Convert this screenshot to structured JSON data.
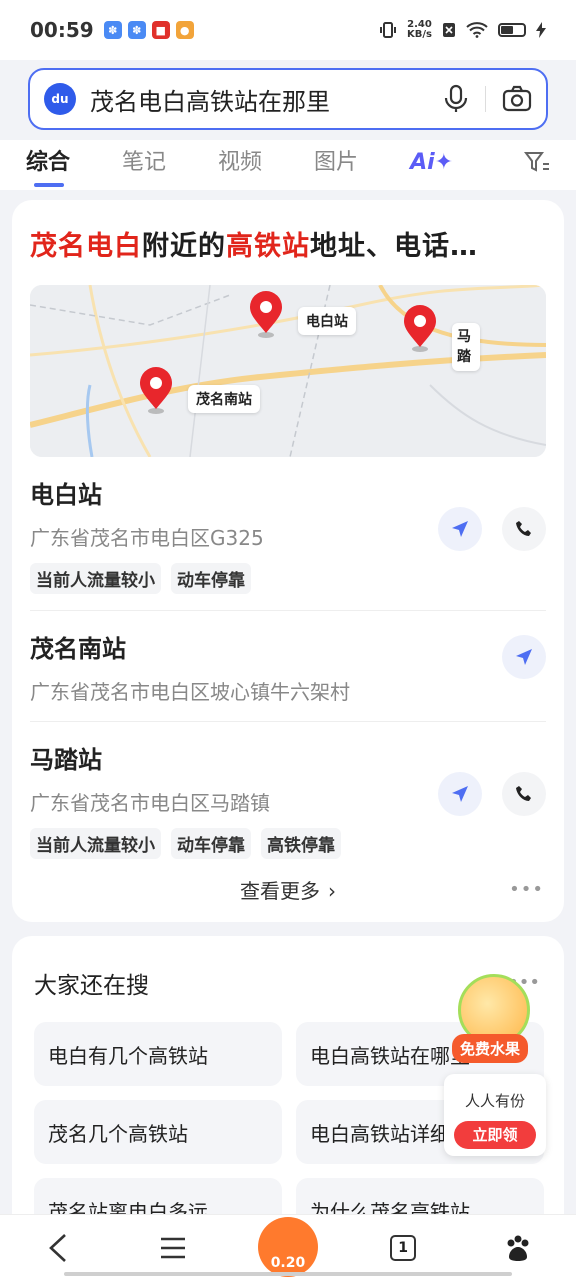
{
  "status": {
    "time": "00:59",
    "net_speed_value": "2.40",
    "net_speed_unit": "KB/s"
  },
  "search": {
    "query": "茂名电白高铁站在那里"
  },
  "tabs": [
    "综合",
    "笔记",
    "视频",
    "图片"
  ],
  "ai_tab_label": "Ai✦",
  "card": {
    "title_part1": "茂名电白",
    "title_part2": "附近的",
    "title_part3": "高铁站",
    "title_part4": "地址、电话…",
    "map_labels": {
      "dianbai": "电白站",
      "maonan": "茂名南站",
      "mata": "马踏"
    },
    "stations": [
      {
        "name": "电白站",
        "address": "广东省茂名市电白区G325",
        "tags": [
          "当前人流量较小",
          "动车停靠"
        ]
      },
      {
        "name": "茂名南站",
        "address": "广东省茂名市电白区坡心镇牛六架村",
        "tags": []
      },
      {
        "name": "马踏站",
        "address": "广东省茂名市电白区马踏镇",
        "tags": [
          "当前人流量较小",
          "动车停靠",
          "高铁停靠"
        ]
      }
    ],
    "more_label": "查看更多"
  },
  "related": {
    "title": "大家还在搜",
    "items": [
      "电白有几个高铁站",
      "电白高铁站在哪里",
      "茂名几个高铁站",
      "电白高铁站详细地址",
      "茂名站离电白多远",
      "为什么茂名高铁站…"
    ]
  },
  "promo": {
    "badge": "免费水果",
    "text": "人人有份",
    "cta": "立即领"
  },
  "bottom": {
    "center_count": "0.20",
    "tab_count": "1"
  },
  "colors": {
    "accent": "#4e6ef2",
    "highlight_red": "#e1251b"
  }
}
